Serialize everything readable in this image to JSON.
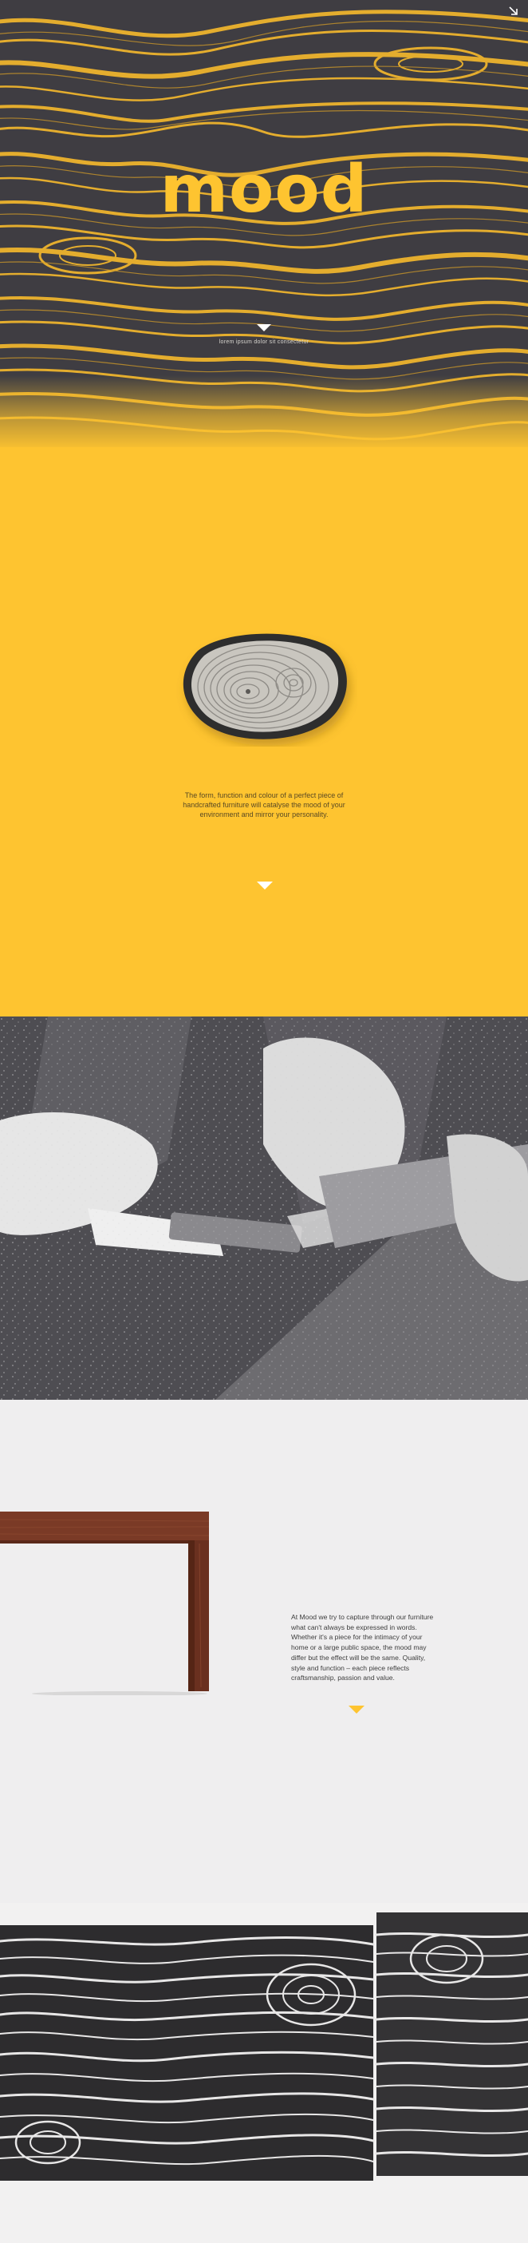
{
  "header": {
    "logo_text": "mood",
    "subtitle": "lorem ipsum dolor sit consectetur",
    "corner_icon": "arrow-icon"
  },
  "intro": {
    "text": "The form, function and colour of a perfect piece of handcrafted furniture will catalyse the mood of your environment and mirror your personality."
  },
  "story": {
    "text": "At Mood we try to capture through our furniture what can't always be expressed in words. Whether it's a piece for the intimacy of your home or a large public space, the mood may differ but the effect will be the same. Quality, style and function – each piece reflects craftsmanship, passion and value."
  },
  "colors": {
    "accent": "#fec430",
    "dark": "#3f3d42",
    "light_bg": "#efeeef",
    "bench_wood": "#7a3a26"
  },
  "icons": [
    "arrow-icon",
    "scroll-down-icon"
  ]
}
